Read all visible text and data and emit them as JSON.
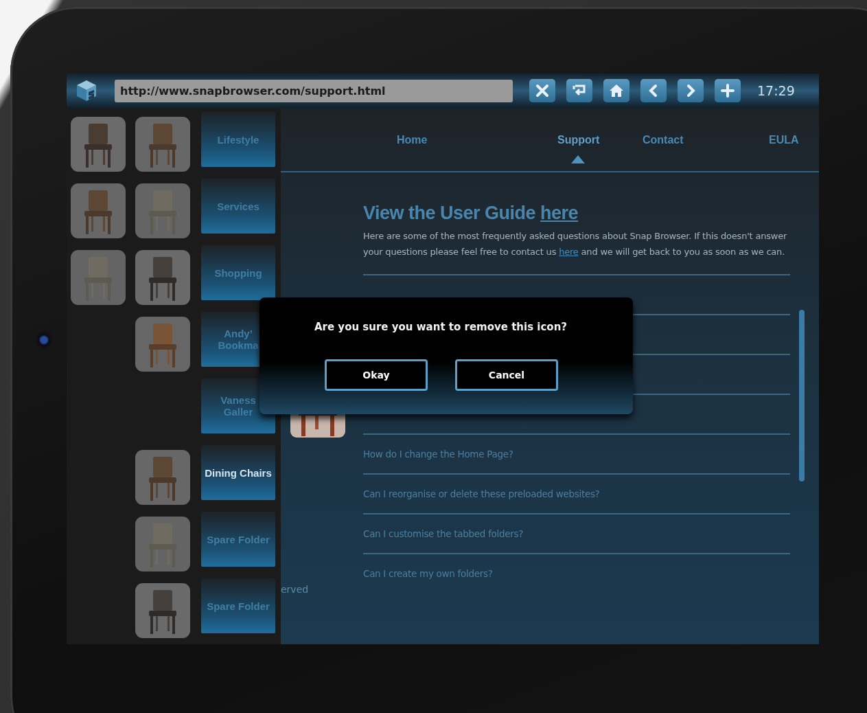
{
  "browser": {
    "url": "http://www.snapbrowser.com/support.html",
    "toolbar_buttons": [
      {
        "kind": "close"
      },
      {
        "kind": "return"
      },
      {
        "kind": "home"
      },
      {
        "kind": "back"
      },
      {
        "kind": "forward"
      },
      {
        "kind": "add"
      }
    ],
    "time": "17:29"
  },
  "folders": [
    {
      "label": "Lifestyle",
      "selected": false,
      "thumbnails": [
        {
          "kind": "picture"
        },
        {
          "kind": "picture"
        }
      ]
    },
    {
      "label": "Services",
      "selected": false,
      "thumbnails": [
        {
          "kind": "picture"
        },
        {
          "kind": "picture"
        }
      ]
    },
    {
      "label": "Shopping",
      "selected": false,
      "thumbnails": [
        {
          "kind": "picture"
        },
        {
          "kind": "picture"
        }
      ]
    },
    {
      "label": "Andy’\nBookma",
      "selected": false,
      "thumbnails": [
        {
          "kind": "empty"
        },
        {
          "kind": "picture"
        }
      ]
    },
    {
      "label": "Vaness\nGaller",
      "selected": false,
      "thumbnails": [
        {
          "kind": "empty"
        },
        {
          "kind": "empty"
        }
      ]
    },
    {
      "label": "Dining Chairs",
      "selected": true,
      "thumbnails": [
        {
          "kind": "empty"
        },
        {
          "kind": "picture"
        }
      ]
    },
    {
      "label": "Spare Folder",
      "selected": false,
      "thumbnails": [
        {
          "kind": "empty"
        },
        {
          "kind": "picture"
        }
      ]
    },
    {
      "label": "Spare Folder",
      "selected": false,
      "thumbnails": [
        {
          "kind": "empty"
        },
        {
          "kind": "picture"
        }
      ]
    }
  ],
  "nav": [
    {
      "label": "Home",
      "selected": false
    },
    {
      "label": "Support",
      "selected": true
    },
    {
      "label": "Contact",
      "selected": false
    },
    {
      "label": "EULA",
      "selected": false
    }
  ],
  "heading": {
    "text": "View the User Guide",
    "link": "here"
  },
  "intro": {
    "before": "Here are some of the most frequently asked questions about Snap Browser. If this doesn't answer your questions please feel free to contact us",
    "link": "here",
    "after": "and we will get back to you as soon as we can."
  },
  "faq": [
    "How do I change the Home Page?",
    "Can I reorganise or delete these preloaded websites?",
    "Can I customise the tabbed folders?",
    "Can I create my own folders?"
  ],
  "footer": "erved",
  "dialog": {
    "message": "Are you sure you want to remove this icon?",
    "buttons": [
      "Okay",
      "Cancel"
    ]
  }
}
